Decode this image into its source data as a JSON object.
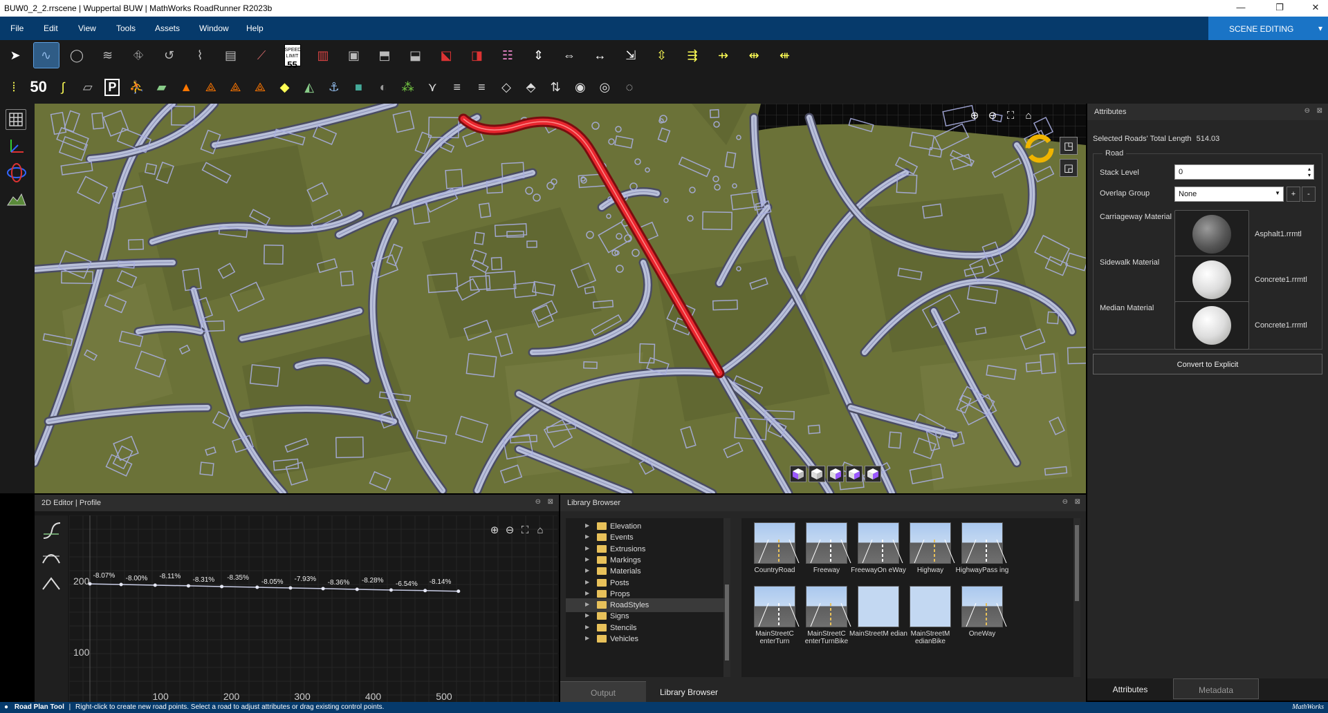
{
  "window": {
    "title": "BUW0_2_2.rrscene | Wuppertal BUW | MathWorks RoadRunner R2023b",
    "controls": [
      "—",
      "❐",
      "✕"
    ]
  },
  "menu": {
    "items": [
      "File",
      "Edit",
      "View",
      "Tools",
      "Assets",
      "Window",
      "Help"
    ],
    "mode": "SCENE EDITING",
    "mode_arrow": "▾"
  },
  "toolbar": {
    "row1": [
      "select-tool",
      "road-plan-tool",
      "junction-tool",
      "road-construction-tool",
      "lane-tool",
      "lane-carve-tool",
      "crosswalk-tool",
      "surface-tool",
      "road-style-tool",
      "speed-limit-tool",
      "signal-tool",
      "lane-marking-tool",
      "maneuver-tool",
      "junction-edit-tool",
      "corner-tool",
      "merge-tool",
      "traffic-signal-tool",
      "lane-width-tool",
      "lane-add-tool",
      "lane-form-tool",
      "elevation-tool",
      "cross-section-tool",
      "lane-split-tool",
      "lane-spread-tool",
      "lane-merge-tool",
      "lane-transition-tool"
    ],
    "speed_sign_top": "SPEED LIMIT",
    "speed_sign_value": "55",
    "speed_label": "50",
    "p_label": "P"
  },
  "attributes": {
    "title": "Attributes",
    "total_length_label": "Selected Roads' Total Length",
    "total_length_value": "514.03",
    "group": "Road",
    "stack_level_label": "Stack Level",
    "stack_level_value": "0",
    "overlap_label": "Overlap Group",
    "overlap_value": "None",
    "plus": "+",
    "minus": "-",
    "carriageway_label": "Carriageway Material",
    "carriageway_value": "Asphalt1.rrmtl",
    "sidewalk_label": "Sidewalk Material",
    "sidewalk_value": "Concrete1.rrmtl",
    "median_label": "Median Material",
    "median_value": "Concrete1.rrmtl",
    "convert_label": "Convert to Explicit",
    "tabs": [
      "Attributes",
      "Metadata"
    ]
  },
  "editor": {
    "title": "2D Editor | Profile",
    "y_labels": [
      "200",
      "100"
    ],
    "x_labels": [
      "100",
      "200",
      "300",
      "400",
      "500"
    ],
    "grades": [
      "-8.07%",
      "-8.00%",
      "-8.11%",
      "-8.31%",
      "-8.35%",
      "-8.05%",
      "-7.93%",
      "-8.36%",
      "-8.28%",
      "-6.54%",
      "-8.14%"
    ]
  },
  "library": {
    "title": "Library Browser",
    "folders": [
      "Elevation",
      "Events",
      "Extrusions",
      "Markings",
      "Materials",
      "Posts",
      "Props",
      "RoadStyles",
      "Signs",
      "Stencils",
      "Vehicles"
    ],
    "selected": "RoadStyles",
    "styles": [
      "CountryRoad",
      "Freeway",
      "FreewayOn eWay",
      "Highway",
      "HighwayPass ing",
      "MainStreetC enterTurn",
      "MainStreetC enterTurnBike",
      "MainStreetM edian",
      "MainStreetM edianBike",
      "OneWay"
    ],
    "tabs": [
      "Output",
      "Library Browser"
    ]
  },
  "status": {
    "tool": "Road Plan Tool",
    "hint": "Right-click to create new road points. Select a road to adjust attributes or drag existing control points.",
    "brand": "MathWorks"
  },
  "colors": {
    "selected_road": "#e8262e",
    "terrain": "#6b7238",
    "menu": "#063a6b",
    "accent": "#1a74c6",
    "road": "#b8bfd8"
  }
}
